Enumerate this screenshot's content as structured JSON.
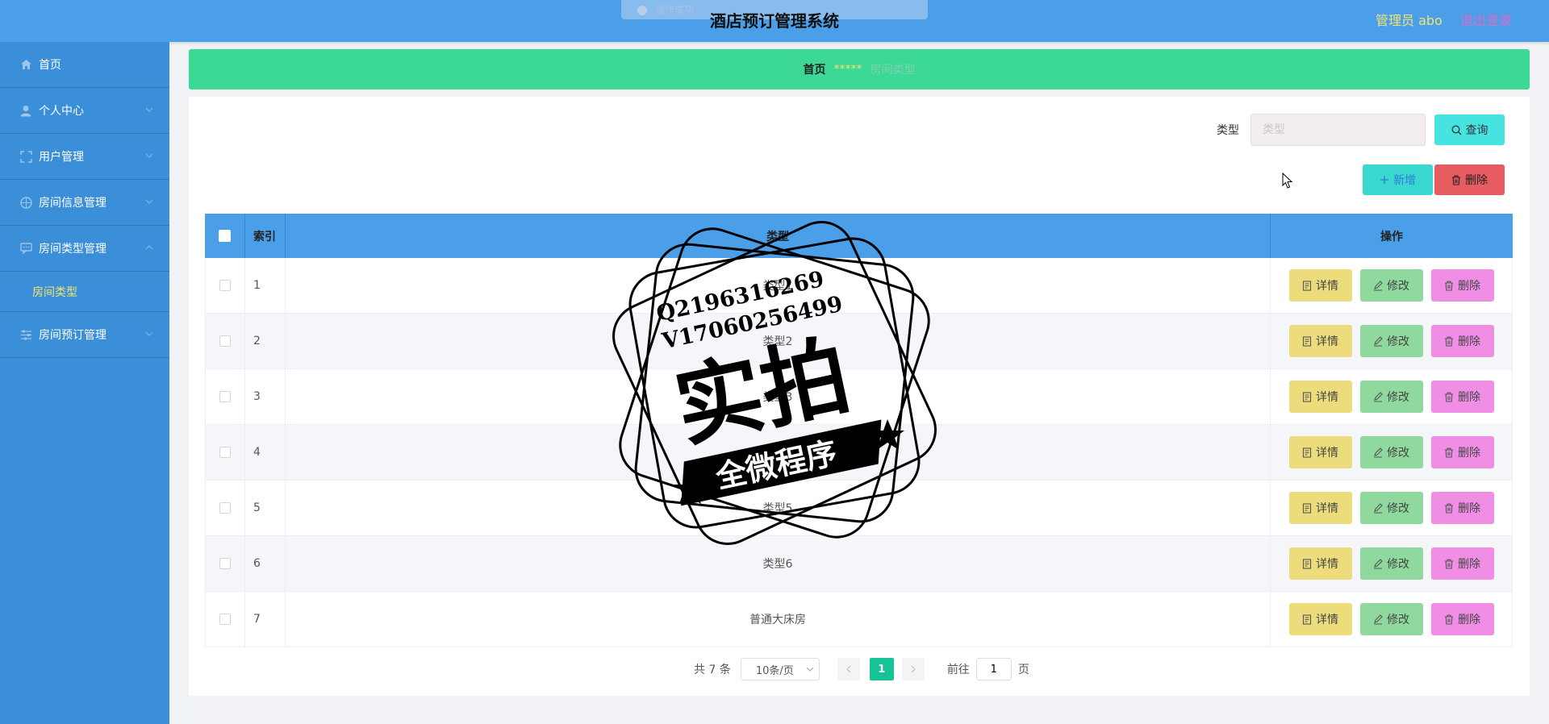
{
  "header": {
    "title": "酒店预订管理系统",
    "user_label": "管理员 abo",
    "logout_label": "退出登录",
    "toast_ghost": "操作成功"
  },
  "sidebar": {
    "items": [
      {
        "label": "首页",
        "icon": "home-icon"
      },
      {
        "label": "个人中心",
        "icon": "user-icon"
      },
      {
        "label": "用户管理",
        "icon": "frame-icon"
      },
      {
        "label": "房间信息管理",
        "icon": "compass-icon"
      },
      {
        "label": "房间类型管理",
        "icon": "chat-icon"
      },
      {
        "label": "房间类型",
        "icon": ""
      },
      {
        "label": "房间预订管理",
        "icon": "sliders-icon"
      }
    ]
  },
  "breadcrumb": {
    "home": "首页",
    "stars": "*****",
    "current": "房间类型"
  },
  "search": {
    "label": "类型",
    "placeholder": "类型",
    "query_label": "查询"
  },
  "toolbar": {
    "add_label": "新增",
    "delete_label": "删除"
  },
  "table": {
    "headers": {
      "index": "索引",
      "type": "类型",
      "ops": "操作"
    },
    "rows": [
      {
        "index": "1",
        "type": "类型1"
      },
      {
        "index": "2",
        "type": "类型2"
      },
      {
        "index": "3",
        "type": "类型3"
      },
      {
        "index": "4",
        "type": "类型4"
      },
      {
        "index": "5",
        "type": "类型5"
      },
      {
        "index": "6",
        "type": "类型6"
      },
      {
        "index": "7",
        "type": "普通大床房"
      }
    ],
    "op_labels": {
      "detail": "详情",
      "edit": "修改",
      "delete": "删除"
    }
  },
  "pagination": {
    "total": "共 7 条",
    "page_size": "10条/页",
    "current": "1",
    "goto_prefix": "前往",
    "goto_value": "1",
    "goto_suffix": "页"
  },
  "watermark": {
    "line1": "Q2196316269",
    "line2": "V17060256499",
    "big": "实拍",
    "banner": "全微程序"
  },
  "colors": {
    "header_bg": "#4a9fe8",
    "sidebar_bg": "#3b8fd9",
    "breadcrumb_bg": "#3bd896",
    "page_active": "#17c294"
  }
}
